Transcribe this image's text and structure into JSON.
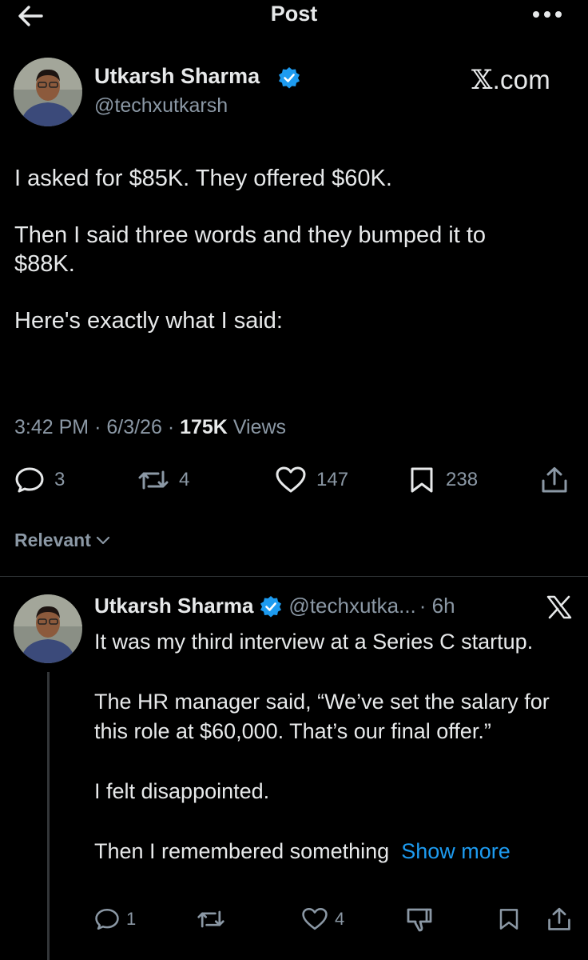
{
  "header": {
    "title": "Post"
  },
  "post": {
    "author_name": "Utkarsh Sharma",
    "author_handle": "@techxutkarsh",
    "source_label": ".com",
    "paragraphs": [
      "I asked for $85K. They offered $60K.",
      "Then I said three words and they bumped it to\n$88K.",
      "Here's exactly what I said:"
    ],
    "time": "3:42 PM",
    "date": "6/3/26",
    "views_count": "175K",
    "views_label": "Views",
    "replies": "3",
    "reposts": "4",
    "likes": "147",
    "bookmarks": "238"
  },
  "sort": {
    "label": "Relevant"
  },
  "reply": {
    "author_name": "Utkarsh Sharma",
    "author_handle": "@techxutka...",
    "age": "· 6h",
    "paragraphs": [
      "It was my third interview at a Series C startup.",
      "The HR manager said, “We’ve set the salary for this role at $60,000. That’s our final offer.”",
      "I felt disappointed."
    ],
    "last_line": "Then I remembered something",
    "show_more": "Show more",
    "replies": "1",
    "likes": "4"
  },
  "colors": {
    "accent": "#1d9bf0",
    "muted": "#8b98a5",
    "background": "#000000",
    "text": "#e7e9ea"
  }
}
